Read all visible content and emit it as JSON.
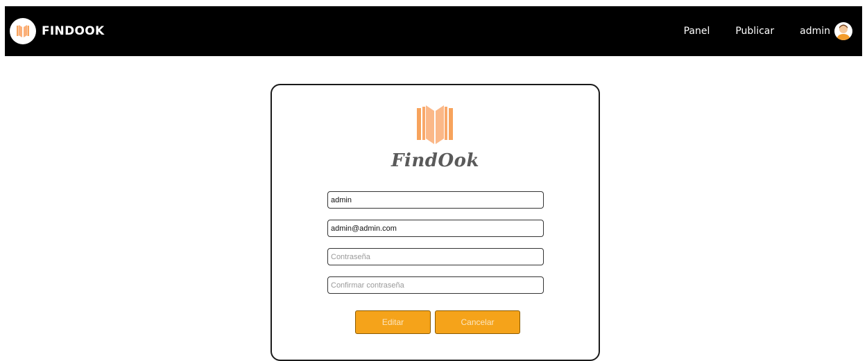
{
  "navbar": {
    "brand": "FINDOOK",
    "links": {
      "panel": "Panel",
      "publicar": "Publicar"
    },
    "user": "admin"
  },
  "card": {
    "title": "FindOok"
  },
  "form": {
    "username": {
      "value": "admin"
    },
    "email": {
      "value": "admin@admin.com"
    },
    "password": {
      "value": "",
      "placeholder": "Contraseña"
    },
    "confirm_password": {
      "value": "",
      "placeholder": "Confirmar contraseña"
    },
    "edit_label": "Editar",
    "cancel_label": "Cancelar"
  },
  "colors": {
    "navbar_bg": "#000000",
    "accent": "#f5a31a",
    "logo_orange": "#fbb07a"
  },
  "icons": {
    "brand": "open-book-icon",
    "avatar": "user-avatar-icon"
  }
}
